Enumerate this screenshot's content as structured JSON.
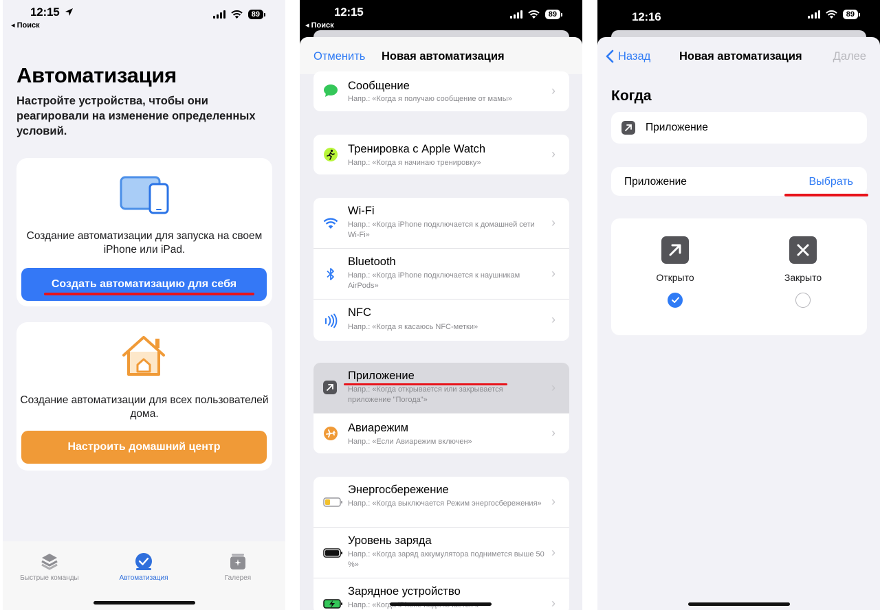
{
  "screen1": {
    "status": {
      "time": "12:15",
      "back": "◂ Поиск",
      "battery": "89"
    },
    "title": "Автоматизация",
    "subtitle": "Настройте устройства, чтобы они реагировали на изменение определенных условий.",
    "card_personal": {
      "text": "Создание автоматизации для запуска на своем iPhone или iPad.",
      "button": "Создать автоматизацию для себя"
    },
    "card_home": {
      "text": "Создание автоматизации для всех пользователей дома.",
      "button": "Настроить домашний центр"
    },
    "tabs": [
      {
        "label": "Быстрые команды"
      },
      {
        "label": "Автоматизация"
      },
      {
        "label": "Галерея"
      }
    ],
    "colors": {
      "primary_button": "#3478f6",
      "home_button": "#f09a37",
      "annotation": "#e8131a"
    }
  },
  "screen2": {
    "status": {
      "time": "12:15",
      "back": "◂ Поиск",
      "battery": "89"
    },
    "cancel": "Отменить",
    "title": "Новая автоматизация",
    "rows": [
      {
        "title": "Сообщение",
        "subtitle": "Напр.: «Когда я получаю сообщение от мамы»",
        "icon": "message-icon"
      },
      {
        "title": "Тренировка с Apple Watch",
        "subtitle": "Напр.: «Когда я начинаю тренировку»",
        "icon": "workout-icon"
      },
      {
        "title": "Wi-Fi",
        "subtitle": "Напр.: «Когда iPhone подключается к домашней сети Wi-Fi»",
        "icon": "wifi-icon"
      },
      {
        "title": "Bluetooth",
        "subtitle": "Напр.: «Когда iPhone подключается к наушникам AirPods»",
        "icon": "bluetooth-icon"
      },
      {
        "title": "NFC",
        "subtitle": "Напр.: «Когда я касаюсь NFC-метки»",
        "icon": "nfc-icon"
      },
      {
        "title": "Приложение",
        "subtitle": "Напр.: «Когда открывается или закрывается приложение \"Погода\"»",
        "icon": "app-icon"
      },
      {
        "title": "Авиарежим",
        "subtitle": "Напр.: «Если Авиарежим включен»",
        "icon": "airplane-icon"
      },
      {
        "title": "Энергосбережение",
        "subtitle": "Напр.: «Когда выключается Режим энергосбережения»",
        "icon": "low-power-icon"
      },
      {
        "title": "Уровень заряда",
        "subtitle": "Напр.: «Когда заряд аккумулятора поднимется выше 50 %»",
        "icon": "battery-level-icon"
      },
      {
        "title": "Зарядное устройство",
        "subtitle": "Напр.: «Когда iPhone подключается к",
        "icon": "charger-icon"
      }
    ]
  },
  "screen3": {
    "status": {
      "time": "12:16",
      "battery": "89"
    },
    "back": "Назад",
    "title": "Новая автоматизация",
    "next": "Далее",
    "when_header": "Когда",
    "trigger": "Приложение",
    "app_row": {
      "label": "Приложение",
      "action": "Выбрать"
    },
    "options": [
      {
        "label": "Открыто",
        "selected": true
      },
      {
        "label": "Закрыто",
        "selected": false
      }
    ]
  }
}
